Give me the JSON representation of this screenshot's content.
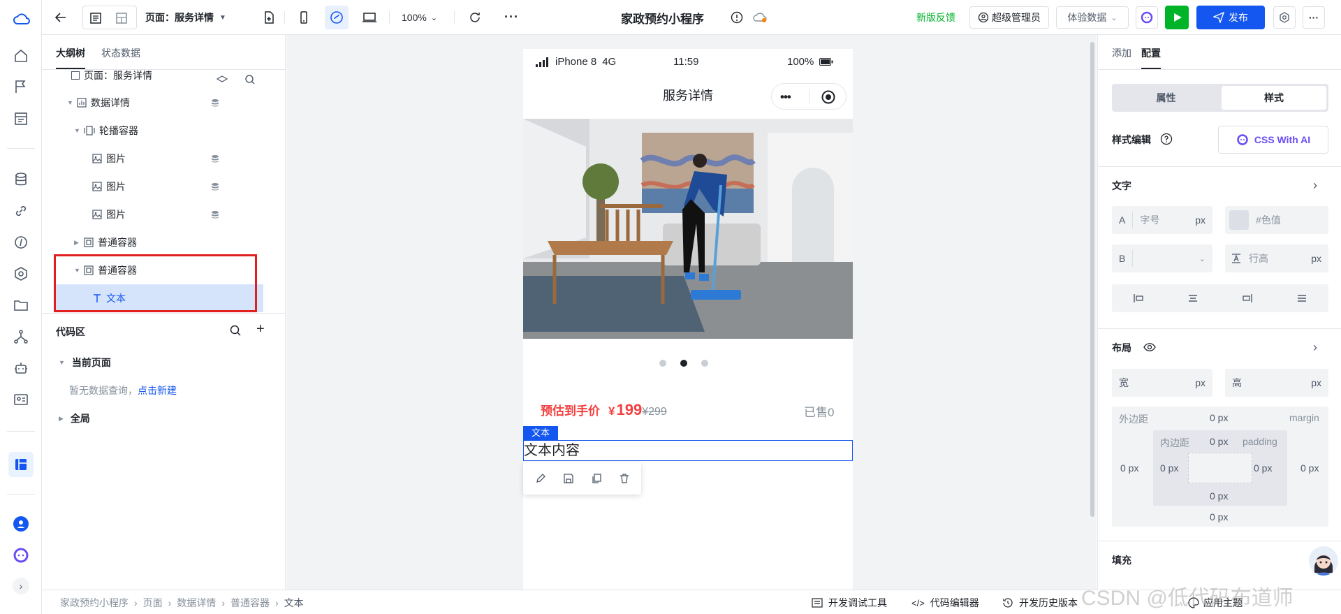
{
  "topbar": {
    "page_label": "页面：服务详情",
    "zoom": "100%",
    "app_title": "家政预约小程序",
    "feedback": "新版反馈",
    "role": "超级管理员",
    "data_mode": "体验数据",
    "publish": "发布"
  },
  "left": {
    "tabs": [
      "大纲树",
      "状态数据"
    ],
    "tree_cut": "页面：服务详情",
    "tree": [
      {
        "label": "数据详情"
      },
      {
        "label": "轮播容器"
      },
      {
        "label": "图片"
      },
      {
        "label": "图片"
      },
      {
        "label": "图片"
      },
      {
        "label": "普通容器"
      },
      {
        "label": "普通容器"
      },
      {
        "label": "文本"
      }
    ],
    "code_area": "代码区",
    "current_page": "当前页面",
    "no_query": "暂无数据查询，",
    "create_link": "点击新建",
    "global": "全局"
  },
  "phone": {
    "carrier": "iPhone 8",
    "network": "4G",
    "time": "11:59",
    "battery": "100%",
    "title": "服务详情",
    "price_label": "预估到手价",
    "currency": "¥",
    "price": "199",
    "old_price": "¥299",
    "sold": "已售0",
    "selected_tag": "文本",
    "text_content": "文本内容"
  },
  "right": {
    "tabs": [
      "添加",
      "配置"
    ],
    "segments": [
      "属性",
      "样式"
    ],
    "style_edit": "样式编辑",
    "css_ai": "CSS With AI",
    "text_section": "文字",
    "font_a": "A",
    "font_size_ph": "字号",
    "unit": "px",
    "color_ph": "#色值",
    "font_b": "B",
    "line_height_ph": "行高",
    "layout_section": "布局",
    "width": "宽",
    "height": "高",
    "margin_cn": "外边距",
    "margin_en": "margin",
    "padding_cn": "内边距",
    "padding_en": "padding",
    "zero": "0 px",
    "fill_section": "填充"
  },
  "bottom": {
    "breadcrumb": [
      "家政预约小程序",
      "页面",
      "数据详情",
      "普通容器",
      "文本"
    ],
    "dev_tools": "开发调试工具",
    "code_editor": "代码编辑器",
    "history": "开发历史版本",
    "theme": "应用主题",
    "watermark": "CSDN @低代码布道师"
  },
  "colors": {
    "accent": "#1456f0",
    "price": "#f53f3f",
    "green": "#00b42a",
    "highlight": "#e8f0fe",
    "redbox": "#e02020"
  }
}
